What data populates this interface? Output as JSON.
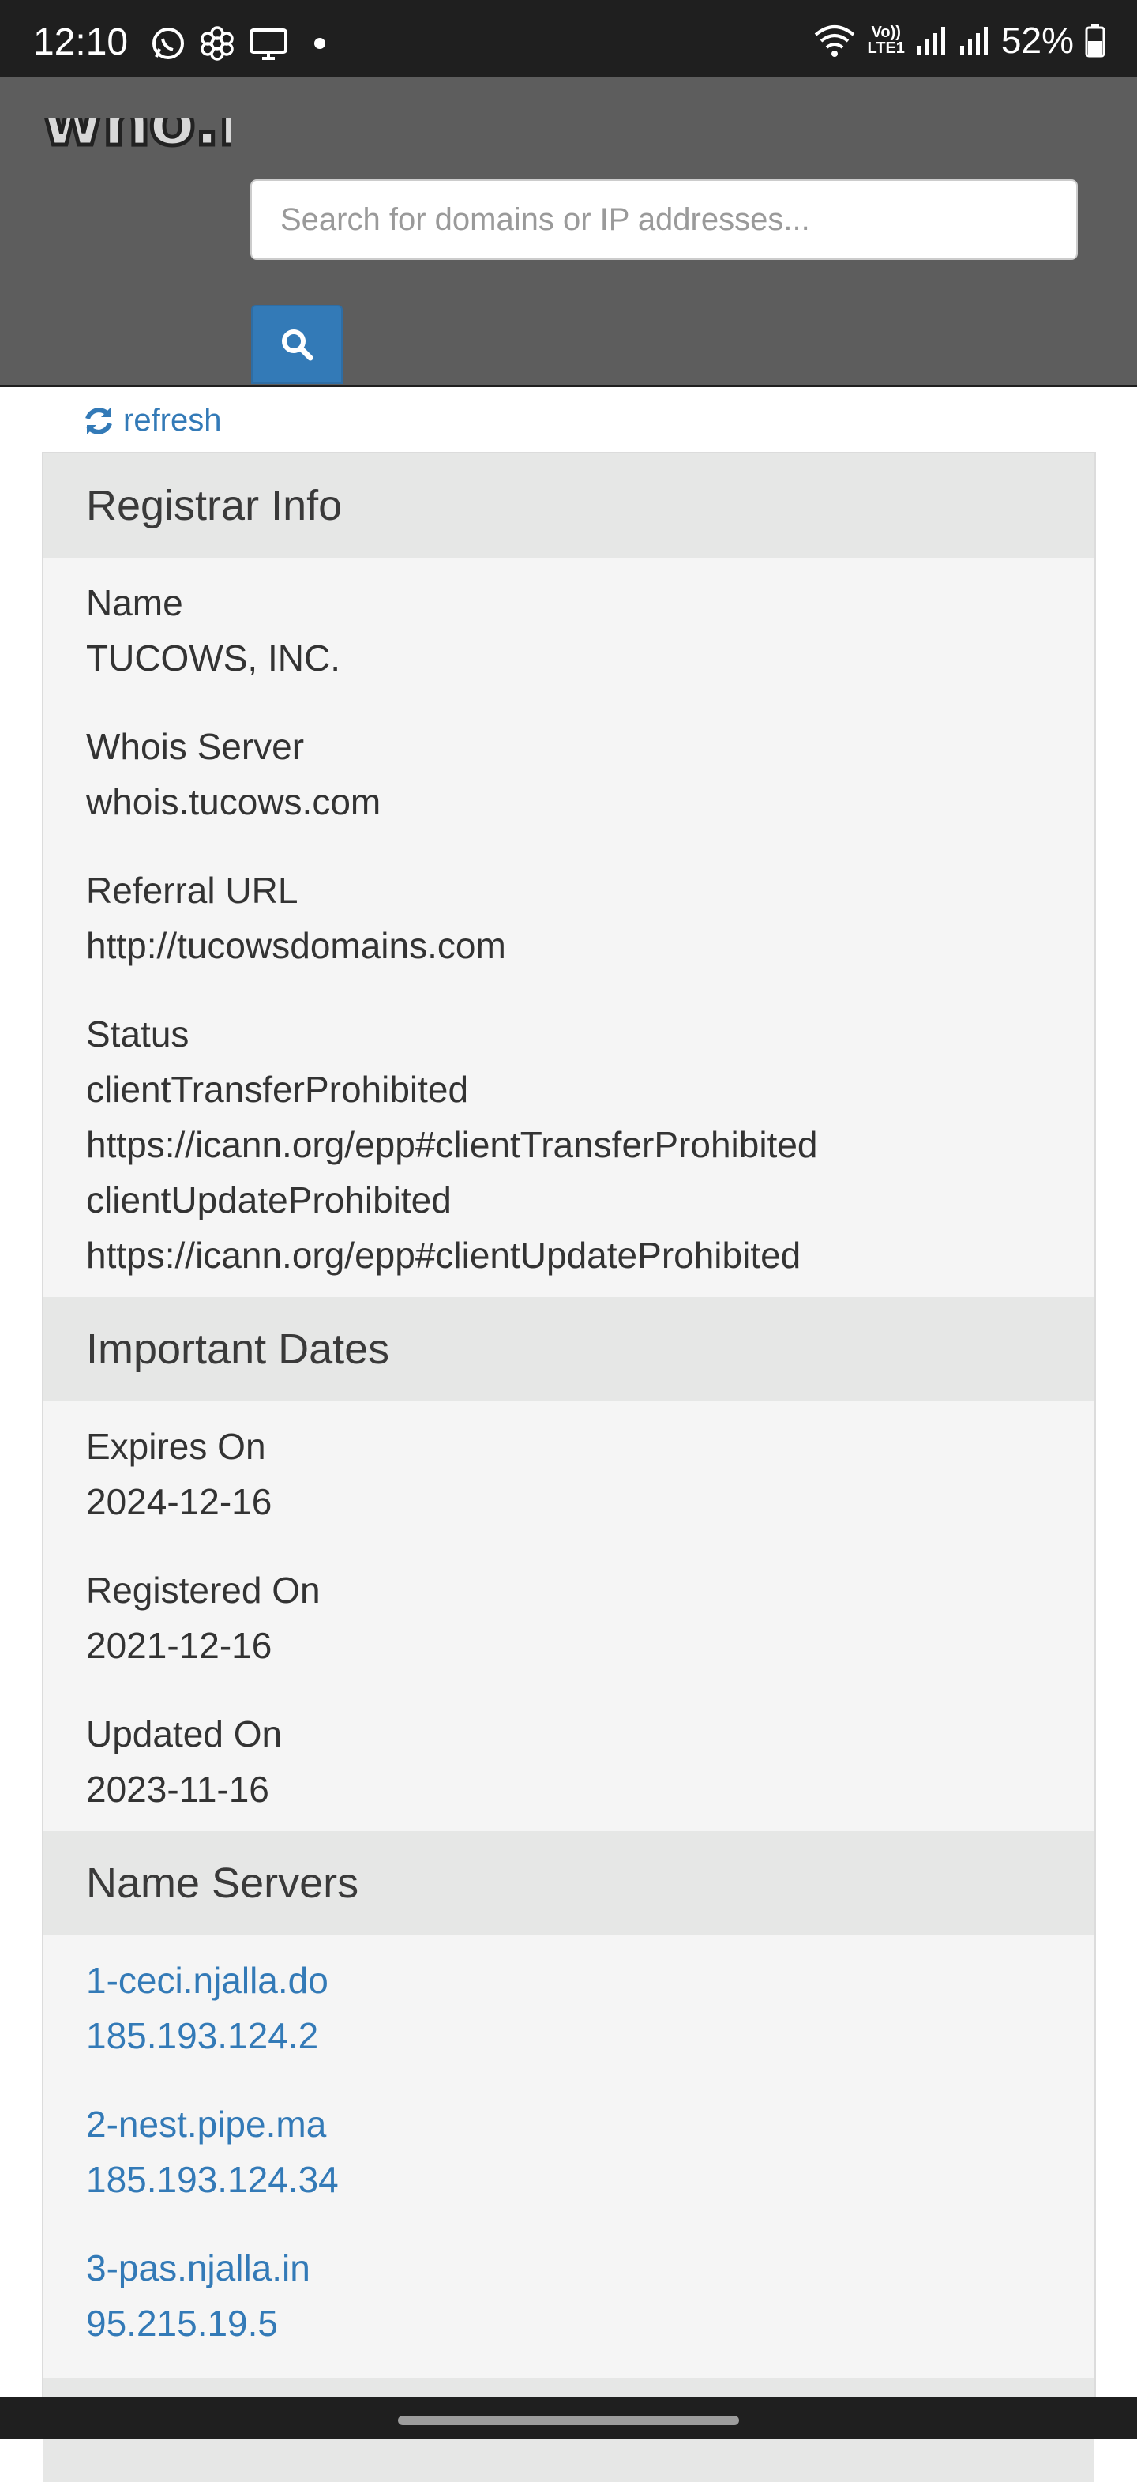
{
  "status_bar": {
    "time": "12:10",
    "volte_top": "Vo))",
    "volte_bottom": "LTE1",
    "battery": "52%"
  },
  "header": {
    "logo_text": "who.is",
    "search_placeholder": "Search for domains or IP addresses..."
  },
  "refresh_label": "refresh",
  "registrar": {
    "title": "Registrar Info",
    "name_label": "Name",
    "name_value": "TUCOWS, INC.",
    "whois_label": "Whois Server",
    "whois_value": "whois.tucows.com",
    "referral_label": "Referral URL",
    "referral_value": "http://tucowsdomains.com",
    "status_label": "Status",
    "status_lines": [
      "clientTransferProhibited",
      "https://icann.org/epp#clientTransferProhibited",
      "clientUpdateProhibited",
      "https://icann.org/epp#clientUpdateProhibited"
    ]
  },
  "dates": {
    "title": "Important Dates",
    "expires_label": "Expires On",
    "expires_value": "2024-12-16",
    "registered_label": "Registered On",
    "registered_value": "2021-12-16",
    "updated_label": "Updated On",
    "updated_value": "2023-11-16"
  },
  "nameservers": {
    "title": "Name Servers",
    "items": [
      {
        "host": "1-ceci.njalla.do",
        "ip": "185.193.124.2"
      },
      {
        "host": "2-nest.pipe.ma",
        "ip": "185.193.124.34"
      },
      {
        "host": "3-pas.njalla.in",
        "ip": "95.215.19.5"
      }
    ]
  },
  "colors": {
    "accent": "#337ab7",
    "header_bg": "#5d5d5d",
    "section_bg": "#e6e7e6",
    "panel_bg": "#f5f5f5"
  }
}
